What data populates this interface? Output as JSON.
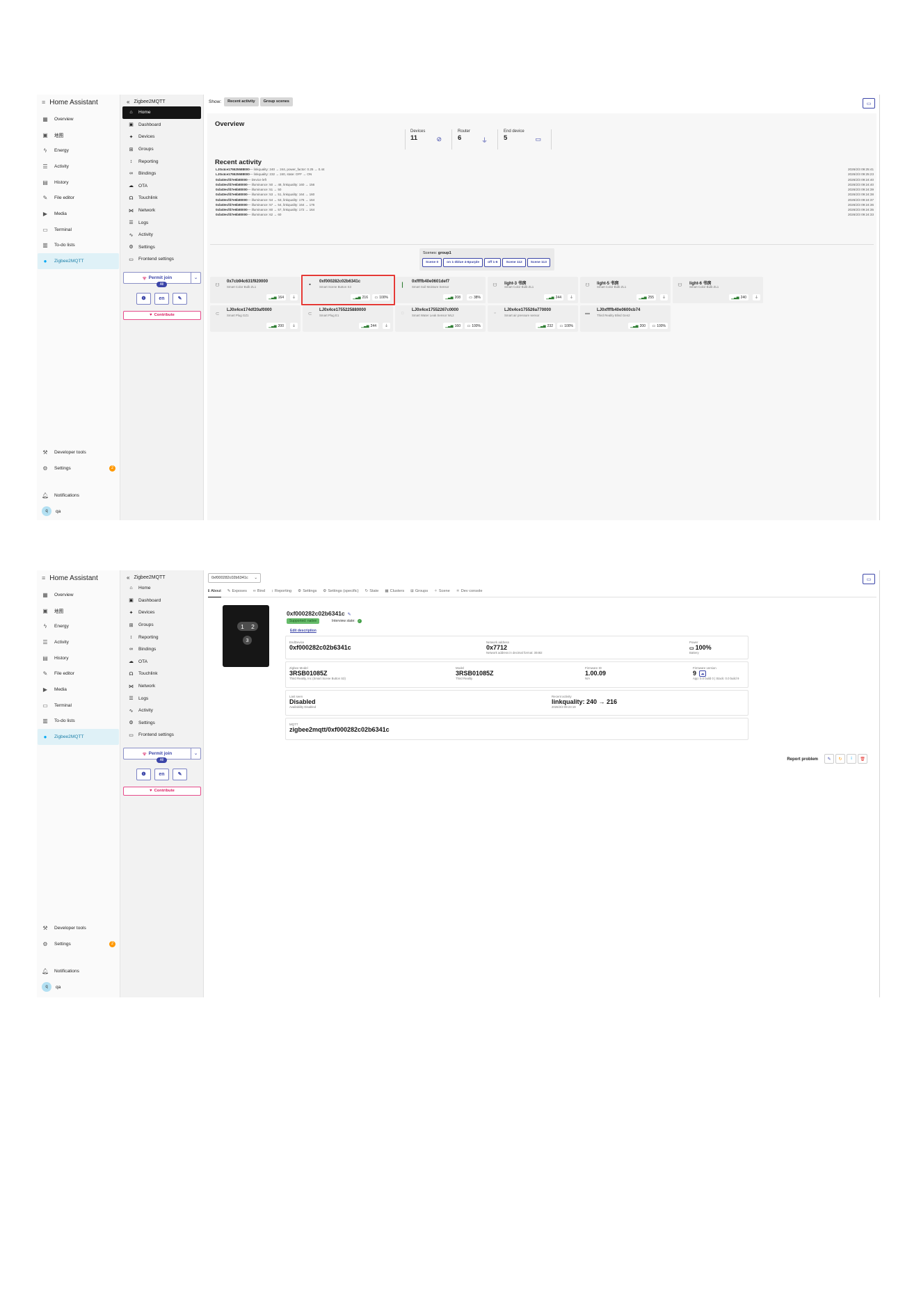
{
  "colors": {
    "accent": "#3b45a8",
    "ha_active": "#03a9f4",
    "highlight": "#e53935",
    "badge": "#ff9800",
    "success": "#43a047"
  },
  "ha": {
    "title": "Home Assistant",
    "menu_icon": "menu-icon",
    "items": [
      {
        "label": "Overview",
        "icon": "grid-icon"
      },
      {
        "label": "地图",
        "icon": "map-icon"
      },
      {
        "label": "Energy",
        "icon": "lightning-icon"
      },
      {
        "label": "Activity",
        "icon": "list-icon"
      },
      {
        "label": "History",
        "icon": "chart-icon"
      },
      {
        "label": "File editor",
        "icon": "wrench-icon"
      },
      {
        "label": "Media",
        "icon": "media-icon"
      },
      {
        "label": "Terminal",
        "icon": "terminal-icon"
      },
      {
        "label": "To-do lists",
        "icon": "todo-icon"
      },
      {
        "label": "Zigbee2MQTT",
        "icon": "zigbee-icon"
      }
    ],
    "developer_tools": "Developer tools",
    "settings": "Settings",
    "settings_badge": "2",
    "notifications": "Notifications",
    "user": "qa",
    "user_initial": "q"
  },
  "z2m": {
    "title": "Zigbee2MQTT",
    "items": [
      {
        "label": "Home",
        "icon": "home-icon"
      },
      {
        "label": "Dashboard",
        "icon": "dashboard-icon"
      },
      {
        "label": "Devices",
        "icon": "devices-icon"
      },
      {
        "label": "Groups",
        "icon": "groups-icon"
      },
      {
        "label": "Reporting",
        "icon": "reporting-icon"
      },
      {
        "label": "Bindings",
        "icon": "bindings-icon"
      },
      {
        "label": "OTA",
        "icon": "ota-icon"
      },
      {
        "label": "Touchlink",
        "icon": "touchlink-icon"
      },
      {
        "label": "Network",
        "icon": "network-icon"
      },
      {
        "label": "Logs",
        "icon": "logs-icon"
      },
      {
        "label": "Activity",
        "icon": "activity-icon"
      },
      {
        "label": "Settings",
        "icon": "settings-icon"
      },
      {
        "label": "Frontend settings",
        "icon": "frontend-icon"
      }
    ],
    "permit_join": "Permit join",
    "permit_scope": "All",
    "lang": "en",
    "contribute": "Contribute"
  },
  "home": {
    "show_label": "Show:",
    "chips": [
      "Recent activity",
      "Group scenes"
    ],
    "overview_title": "Overview",
    "stats": [
      {
        "label": "Devices",
        "value": "11",
        "icon": "devices-blocked-icon"
      },
      {
        "label": "Router",
        "value": "6",
        "icon": "plug-icon"
      },
      {
        "label": "End device",
        "value": "5",
        "icon": "battery-icon"
      }
    ],
    "recent_title": "Recent activity",
    "activity": [
      {
        "device": "LJ0x4ce175525588000",
        "text": "— linkquality: 240 → 244, power_factor: 0.25 → 0.44",
        "time": "2026/2/3 09:25:41"
      },
      {
        "device": "LJ0x4ce175525588000",
        "text": "— linkquality: 232 → 240, state: OFF → ON",
        "time": "2026/2/3 09:25:23"
      },
      {
        "device": "0xb40ecfd7e6b80000",
        "text": "— Device left",
        "time": "2026/2/3 09:24:40"
      },
      {
        "device": "0xb40ecfd7e6b80000",
        "text": "— illuminance: 50 → 48, linkquality: 160 → 156",
        "time": "2026/2/3 09:24:40"
      },
      {
        "device": "0xb40ecfd7e6b80000",
        "text": "— illuminance: 51 → 50",
        "time": "2026/2/3 09:24:39"
      },
      {
        "device": "0xb40ecfd7e6b80000",
        "text": "— illuminance: 53 → 51, linkquality: 164 → 160",
        "time": "2026/2/3 09:24:38"
      },
      {
        "device": "0xb40ecfd7e6b80000",
        "text": "— illuminance: 54 → 53, linkquality: 176 → 164",
        "time": "2026/2/3 09:24:37"
      },
      {
        "device": "0xb40ecfd7e6b80000",
        "text": "— illuminance: 57 → 54, linkquality: 164 → 176",
        "time": "2026/2/3 09:24:36"
      },
      {
        "device": "0xb40ecfd7e6b80000",
        "text": "— illuminance: 60 → 57, linkquality: 172 → 164",
        "time": "2026/2/3 09:24:35"
      },
      {
        "device": "0xb40ecfd7e6b80000",
        "text": "— illuminance: 62 → 60",
        "time": "2026/2/3 09:24:33"
      }
    ],
    "scenes_label": "Scenes:",
    "scenes_group": "group1",
    "scene_buttons": [
      "Scene 0",
      "on 1-3blue 4-6purple",
      "off 1-6",
      "Scene 112",
      "Scene 113"
    ],
    "devices": [
      {
        "name": "0x7cb94c631f920000",
        "model": "Smart Color Bulb ZL1",
        "lq": "164",
        "power": "plug",
        "icon": "bulb-icon"
      },
      {
        "name": "0xf000282c02b6341c",
        "model": "Smart Scene Button S3",
        "lq": "216",
        "power": "100%",
        "icon": "button-icon"
      },
      {
        "name": "0xffffb40e0601def7",
        "model": "Smart Soil Moisture Sensor",
        "lq": "208",
        "power": "38%",
        "icon": "probe-icon"
      },
      {
        "name": "light-3 书房",
        "model": "Smart Color Bulb ZL1",
        "lq": "244",
        "power": "plug",
        "icon": "bulb-icon"
      },
      {
        "name": "light-5 书房",
        "model": "Smart Color Bulb ZL1",
        "lq": "255",
        "power": "plug",
        "icon": "bulb-icon"
      },
      {
        "name": "light-6 书房",
        "model": "Smart Color Bulb ZL1",
        "lq": "240",
        "power": "plug",
        "icon": "bulb-icon"
      },
      {
        "name": "LJ0x4ce174df20af0000",
        "model": "Smart Plug GZ1",
        "lq": "200",
        "power": "plug",
        "icon": "plug-device-icon"
      },
      {
        "name": "LJ0x4ce1755225880000",
        "model": "Smart Plug E1",
        "lq": "244",
        "power": "plug",
        "icon": "plug-device-icon"
      },
      {
        "name": "LJ0x4ce17552267c0000",
        "model": "Smart Water Leak Sensor WL2",
        "lq": "160",
        "power": "100%",
        "icon": "drop-icon"
      },
      {
        "name": "LJ0x4ce175526a770000",
        "model": "Smart air pressure sensor",
        "lq": "232",
        "power": "100%",
        "icon": "sensor-icon"
      },
      {
        "name": "LJ0xffffb40e0600cb74",
        "model": "Third Reality Blind Gen2",
        "lq": "200",
        "power": "100%",
        "icon": "blind-icon"
      }
    ]
  },
  "detail": {
    "device_select": "0xf000282c02b6341c",
    "tabs": [
      "About",
      "Exposes",
      "Bind",
      "Reporting",
      "Settings",
      "Settings (specific)",
      "State",
      "Clusters",
      "Groups",
      "Scene",
      "Dev console"
    ],
    "name": "0xf000282c02b6341c",
    "support_badge": "Supported: native",
    "interview_label": "Interview state:",
    "edit_description": "Edit description",
    "image_buttons": [
      "1",
      "2",
      "3"
    ],
    "card1": {
      "type_label": "EndDevice",
      "type_value": "0xf000282c02b6341c",
      "nw_label": "Network address",
      "nw_value": "0x7712",
      "nw_sub": "Network address in decimal format: 30482",
      "power_label": "Power",
      "power_value": "100%",
      "power_sub": "Battery"
    },
    "card2": {
      "zm_label": "Zigbee Model",
      "zm_value": "3RSB01085Z",
      "zm_sub": "Third Reality, Inc (Smart Scene Button S3)",
      "model_label": "Model",
      "model_value": "3RSB01085Z",
      "model_sub": "Third Reality",
      "fwid_label": "Firmware ID",
      "fwid_value": "1.00.09",
      "fwid_sub": "N/A",
      "fwv_label": "Firmware version",
      "fwv_value": "9",
      "fwv_sub": "App: 0.0 build 0 | Stack: 0.0 build 9"
    },
    "card3": {
      "ls_label": "Last seen",
      "ls_value": "Disabled",
      "ls_sub": "Availability Disabled",
      "ra_label": "Recent activity",
      "ra_value": "linkquality: 240 → 216",
      "ra_sub": "2026/2/3 09:23:19"
    },
    "card4": {
      "mqtt_label": "MQTT",
      "mqtt_value": "zigbee2mqtt/0xf000282c02b6341c"
    },
    "report_problem": "Report problem"
  }
}
